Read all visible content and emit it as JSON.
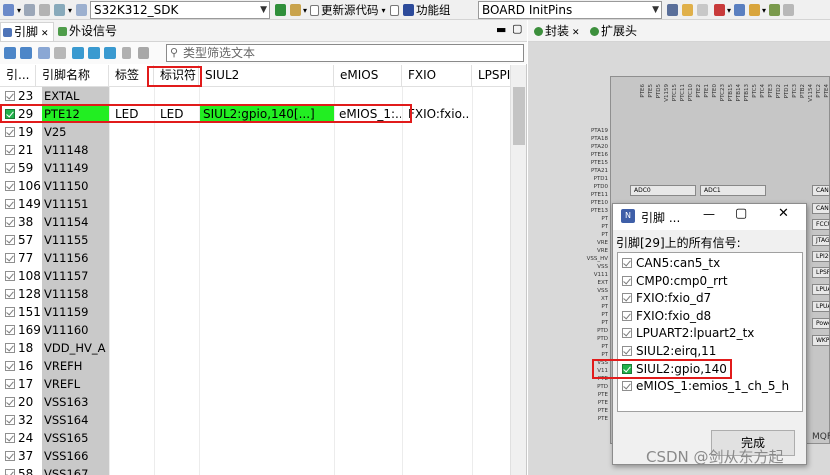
{
  "toolbar": {
    "sdk_combo": "S32K312_SDK",
    "update_source": "更新源代码",
    "function_group_label": "功能组",
    "function_group_value": "BOARD InitPins"
  },
  "left_tabs": [
    {
      "label": "引脚"
    },
    {
      "label": "外设信号"
    }
  ],
  "search": {
    "placeholder": "类型筛选文本"
  },
  "columns": [
    "引...",
    "引脚名称",
    "标签",
    "标识符",
    "SIUL2",
    "eMIOS",
    "FXIO",
    "LPSPI"
  ],
  "rows": [
    {
      "num": "23",
      "name": "EXTAL"
    },
    {
      "num": "29",
      "name": "PTE12",
      "label": "LED",
      "ident": "LED",
      "siul2": "SIUL2:gpio,140[...]",
      "emios": "eMIOS_1:...",
      "fxio": "FXIO:fxio..."
    },
    {
      "num": "19",
      "name": "V25"
    },
    {
      "num": "21",
      "name": "V11148"
    },
    {
      "num": "59",
      "name": "V11149"
    },
    {
      "num": "106",
      "name": "V11150"
    },
    {
      "num": "149",
      "name": "V11151"
    },
    {
      "num": "38",
      "name": "V11154"
    },
    {
      "num": "57",
      "name": "V11155"
    },
    {
      "num": "77",
      "name": "V11156"
    },
    {
      "num": "108",
      "name": "V11157"
    },
    {
      "num": "128",
      "name": "V11158"
    },
    {
      "num": "151",
      "name": "V11159"
    },
    {
      "num": "169",
      "name": "V11160"
    },
    {
      "num": "18",
      "name": "VDD_HV_A"
    },
    {
      "num": "16",
      "name": "VREFH"
    },
    {
      "num": "17",
      "name": "VREFL"
    },
    {
      "num": "20",
      "name": "VSS163"
    },
    {
      "num": "32",
      "name": "VSS164"
    },
    {
      "num": "24",
      "name": "VSS165"
    },
    {
      "num": "37",
      "name": "VSS166"
    },
    {
      "num": "58",
      "name": "VSS167"
    }
  ],
  "right_tabs": [
    {
      "label": "封装"
    },
    {
      "label": "扩展头"
    }
  ],
  "package": {
    "top_pins": [
      "PTE6",
      "PTE5",
      "PTD5",
      "V1159",
      "PTC15",
      "PTC11",
      "PTC10",
      "PTE2",
      "PTE1",
      "PTE0",
      "PTC23",
      "PTB15",
      "PTB14",
      "PTB13",
      "PTC5",
      "PTC4",
      "PTE3",
      "PTD2",
      "PTD1",
      "PTC3",
      "PTB2",
      "V1154",
      "PTC2",
      "PTE4"
    ],
    "left_pins": [
      "PTA19",
      "PTA18",
      "PTA20",
      "PTE16",
      "PTE15",
      "PTA21",
      "PTD1",
      "PTD0",
      "PTE11",
      "PTE10",
      "PTE13",
      "PT",
      "PT",
      "PT",
      "VRE",
      "VRE",
      "VSS_HV",
      "VSS",
      "V111",
      "EXT",
      "VSS",
      "XT",
      "PT",
      "PT",
      "PT",
      "PTD",
      "PTD",
      "PT",
      "PT",
      "VSS",
      "V11",
      "PTE",
      "PTD",
      "PTE",
      "PTE",
      "PTE",
      "PTE"
    ],
    "peripheral_boxes": [
      "ADC0",
      "ADC1",
      "CAN0",
      "CAN4",
      "FCCU",
      "JTAG",
      "LPI2C0",
      "LPSPI",
      "LPUART",
      "LPUART",
      "Power",
      "WKPU"
    ]
  },
  "dialog": {
    "title": "引脚 ...",
    "heading": "引脚[29]上的所有信号:",
    "items": [
      {
        "label": "CAN5:can5_tx",
        "checked": false
      },
      {
        "label": "CMP0:cmp0_rrt",
        "checked": false
      },
      {
        "label": "FXIO:fxio_d7",
        "checked": false
      },
      {
        "label": "FXIO:fxio_d8",
        "checked": false
      },
      {
        "label": "LPUART2:lpuart2_tx",
        "checked": false
      },
      {
        "label": "SIUL2:eirq,11",
        "checked": false
      },
      {
        "label": "SIUL2:gpio,140",
        "checked": true
      },
      {
        "label": "eMIOS_1:emios_1_ch_5_h",
        "checked": false
      }
    ],
    "done_label": "完成"
  },
  "watermark": "CSDN @剑从东方起",
  "colors": {
    "green": "#22ee22",
    "highlight": "#e11b1b",
    "name_cell": "#c9c9c9"
  }
}
